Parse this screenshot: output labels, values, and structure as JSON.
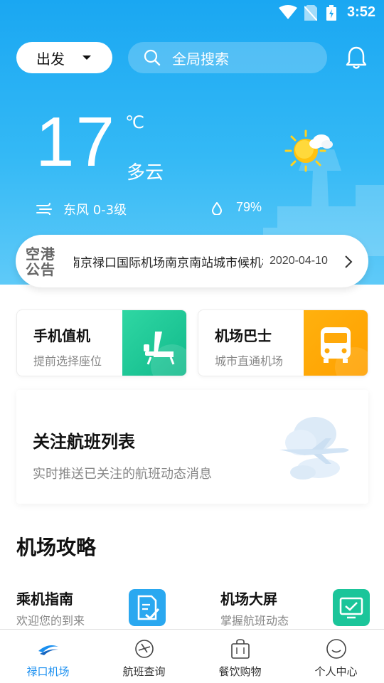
{
  "status": {
    "time": "3:52"
  },
  "header": {
    "departure_label": "出发",
    "search_placeholder": "全局搜索"
  },
  "weather": {
    "temperature": "17",
    "unit": "℃",
    "description": "多云",
    "wind": "东风 0-3级",
    "humidity": "79%"
  },
  "notice": {
    "label": "空港公告",
    "text": "南京禄口国际机场南京南站城市候机楼",
    "date": "2020-04-10"
  },
  "services": [
    {
      "title": "手机值机",
      "subtitle": "提前选择座位",
      "color": "#1cc496"
    },
    {
      "title": "机场巴士",
      "subtitle": "城市直通机场",
      "color": "#ffa90a"
    }
  ],
  "follow_card": {
    "title": "关注航班列表",
    "subtitle": "实时推送已关注的航班动态消息"
  },
  "guide": {
    "section_title": "机场攻略",
    "items": [
      {
        "title": "乘机指南",
        "subtitle": "欢迎您的到来",
        "color": "#2aa8f0"
      },
      {
        "title": "机场大屏",
        "subtitle": "掌握航班动态",
        "color": "#1bc59a"
      }
    ]
  },
  "tabs": [
    {
      "label": "禄口机场",
      "active": true
    },
    {
      "label": "航班查询",
      "active": false
    },
    {
      "label": "餐饮购物",
      "active": false
    },
    {
      "label": "个人中心",
      "active": false
    }
  ],
  "colors": {
    "primary": "#1aa7f2",
    "accent_blue": "#1a8ff0"
  }
}
